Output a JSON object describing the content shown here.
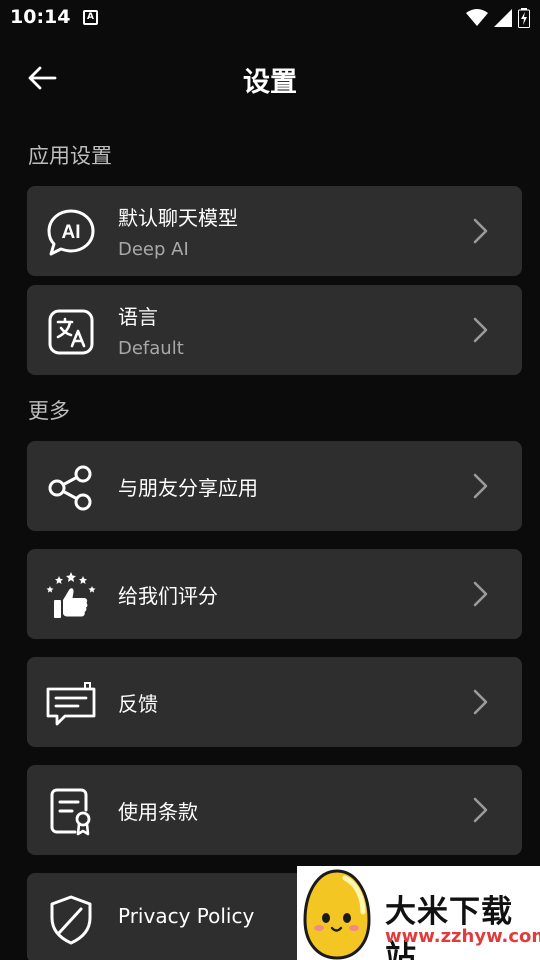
{
  "status_bar": {
    "time": "10:14",
    "notification_glyph": "A"
  },
  "header": {
    "title": "设置",
    "back_icon": "arrow-left-icon"
  },
  "sections": [
    {
      "label": "应用设置"
    },
    {
      "label": "更多"
    }
  ],
  "items": {
    "default_model": {
      "title": "默认聊天模型",
      "subtitle": "Deep AI",
      "icon": "ai-chat-bubble-icon"
    },
    "language": {
      "title": "语言",
      "subtitle": "Default",
      "icon": "translate-icon"
    },
    "share": {
      "title": "与朋友分享应用",
      "icon": "share-icon"
    },
    "rate": {
      "title": "给我们评分",
      "icon": "thumbs-up-stars-icon"
    },
    "feedback": {
      "title": "反馈",
      "icon": "feedback-message-icon"
    },
    "terms": {
      "title": "使用条款",
      "icon": "terms-document-icon"
    },
    "privacy": {
      "title": "Privacy Policy",
      "icon": "shield-icon"
    }
  },
  "watermark": {
    "name": "大米下载站",
    "url": "www.zzhyw.com"
  },
  "colors": {
    "background": "#0b0b0b",
    "card": "#2e2e2e",
    "text": "#ffffff",
    "subtext": "#a8a8a8"
  }
}
